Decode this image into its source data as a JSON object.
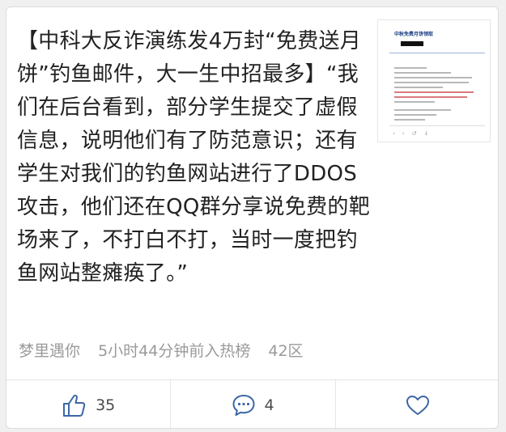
{
  "post": {
    "text": "【中科大反诈演练发4万封“免费送月饼”钓鱼邮件，大一生中招最多】“我们在后台看到，部分学生提交了虚假信息，说明他们有了防范意识；还有学生对我们的钓鱼网站进行了DDOS攻击，他们还在QQ群分享说免费的靶场来了，不打白不打，当时一度把钓鱼网站整瘫痪了。”",
    "author": "梦里遇你",
    "time": "5小时44分钟前入热榜",
    "region": "42区"
  },
  "thumbnail": {
    "title": "中秋免费月饼领取"
  },
  "actions": {
    "like_count": "35",
    "comment_count": "4"
  },
  "colors": {
    "accent": "#3c67a6",
    "meta": "#9a9a9a",
    "text": "#222222"
  },
  "icons": {
    "like": "thumbs-up-icon",
    "comment": "comment-bubble-icon",
    "favorite": "heart-icon"
  }
}
